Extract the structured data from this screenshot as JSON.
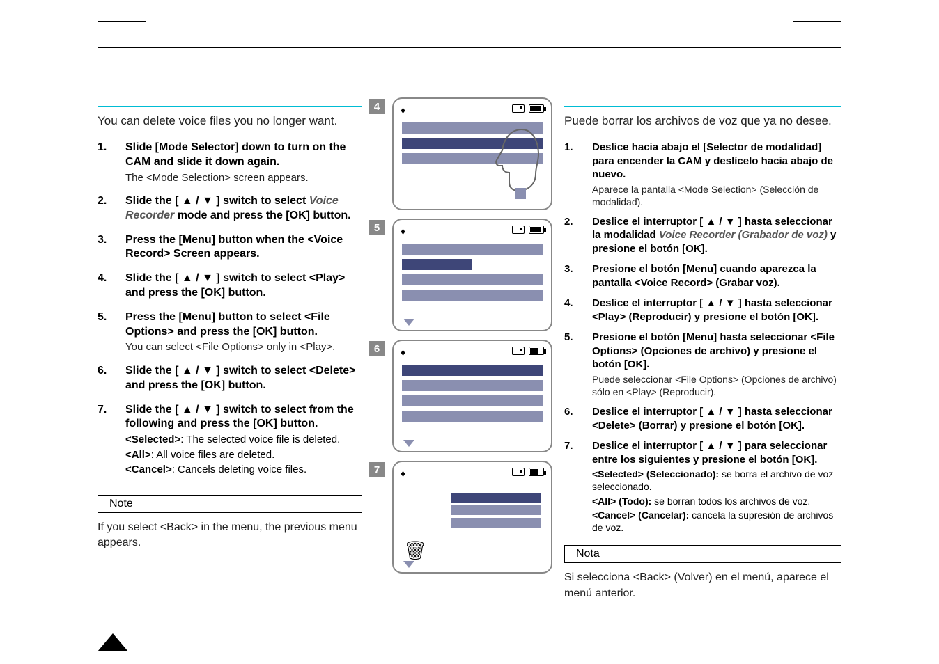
{
  "left": {
    "intro": "You can delete voice files you no longer want.",
    "steps": [
      {
        "num": "1.",
        "title": "Slide [Mode Selector] down to turn on the CAM and slide it down again.",
        "sub": "The <Mode Selection> screen appears."
      },
      {
        "num": "2.",
        "title_pre": "Slide the [ ▲ / ▼ ] switch to select ",
        "title_ital": "Voice Recorder",
        "title_post": " mode and press the [OK] button."
      },
      {
        "num": "3.",
        "title": "Press the [Menu] button when the <Voice Record> Screen appears."
      },
      {
        "num": "4.",
        "title": "Slide the [ ▲ / ▼ ] switch to select <Play> and press the [OK] button."
      },
      {
        "num": "5.",
        "title": "Press the [Menu] button to select <File Options> and press the [OK] button.",
        "sub": "You can select <File Options> only in <Play>."
      },
      {
        "num": "6.",
        "title": "Slide the [ ▲ / ▼ ] switch to select <Delete> and press the [OK] button."
      },
      {
        "num": "7.",
        "title": "Slide the [ ▲ / ▼ ] switch to select from the following and press the [OK] button.",
        "opts": [
          {
            "label": "<Selected>",
            "desc": ": The selected voice file is deleted."
          },
          {
            "label": "<All>",
            "desc": ": All voice files are deleted."
          },
          {
            "label": "<Cancel>",
            "desc": ": Cancels deleting voice files."
          }
        ]
      }
    ],
    "note_label": "Note",
    "note_text": "If you select <Back> in the menu, the previous menu appears."
  },
  "right": {
    "intro": "Puede borrar los archivos de voz que ya no desee.",
    "steps": [
      {
        "num": "1.",
        "title": "Deslice hacia abajo el [Selector de modalidad] para encender la CAM y deslícelo hacia abajo de nuevo.",
        "sub": "Aparece la pantalla <Mode Selection> (Selección de modalidad)."
      },
      {
        "num": "2.",
        "title_pre": "Deslice el interruptor [ ▲ / ▼ ] hasta seleccionar la modalidad ",
        "title_ital": "Voice Recorder (Grabador de voz)",
        "title_post": " y presione el botón [OK]."
      },
      {
        "num": "3.",
        "title": "Presione el botón [Menu] cuando aparezca la pantalla <Voice Record> (Grabar voz)."
      },
      {
        "num": "4.",
        "title": "Deslice el interruptor [ ▲ / ▼ ] hasta seleccionar <Play> (Reproducir) y presione el botón [OK]."
      },
      {
        "num": "5.",
        "title": "Presione el botón [Menu] hasta seleccionar <File Options> (Opciones de archivo) y presione el botón [OK].",
        "sub": "Puede seleccionar <File Options> (Opciones de archivo) sólo en <Play> (Reproducir)."
      },
      {
        "num": "6.",
        "title": "Deslice el interruptor [ ▲ / ▼ ] hasta seleccionar <Delete> (Borrar) y presione el botón [OK]."
      },
      {
        "num": "7.",
        "title": "Deslice el interruptor [ ▲ / ▼ ] para seleccionar entre los siguientes y presione el botón [OK].",
        "opts": [
          {
            "label": "<Selected> (Seleccionado):",
            "desc": " se borra el archivo de voz seleccionado."
          },
          {
            "label": "<All> (Todo):",
            "desc": " se borran todos los archivos de voz."
          },
          {
            "label": "<Cancel> (Cancelar):",
            "desc": " cancela la supresión de archivos de voz."
          }
        ]
      }
    ],
    "note_label": "Nota",
    "note_text": "Si selecciona <Back> (Volver) en el menú, aparece el menú anterior."
  },
  "figures": {
    "nums": [
      "4",
      "5",
      "6",
      "7"
    ],
    "mic_glyph": "♦",
    "trash_glyph": "🗑"
  }
}
